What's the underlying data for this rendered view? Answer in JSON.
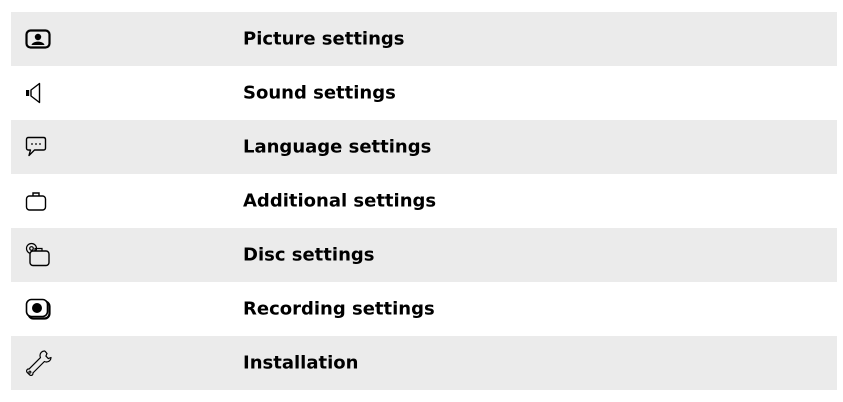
{
  "menu": {
    "items": [
      {
        "label": "Picture settings",
        "icon": "picture-settings-icon"
      },
      {
        "label": "Sound settings",
        "icon": "speaker-icon"
      },
      {
        "label": "Language settings",
        "icon": "speech-bubble-icon"
      },
      {
        "label": "Additional settings",
        "icon": "briefcase-icon"
      },
      {
        "label": "Disc settings",
        "icon": "disc-tray-icon"
      },
      {
        "label": "Recording settings",
        "icon": "record-icon"
      },
      {
        "label": "Installation",
        "icon": "wrench-icon"
      }
    ]
  },
  "colors": {
    "row_shade": "#ebebeb",
    "text": "#000000"
  }
}
